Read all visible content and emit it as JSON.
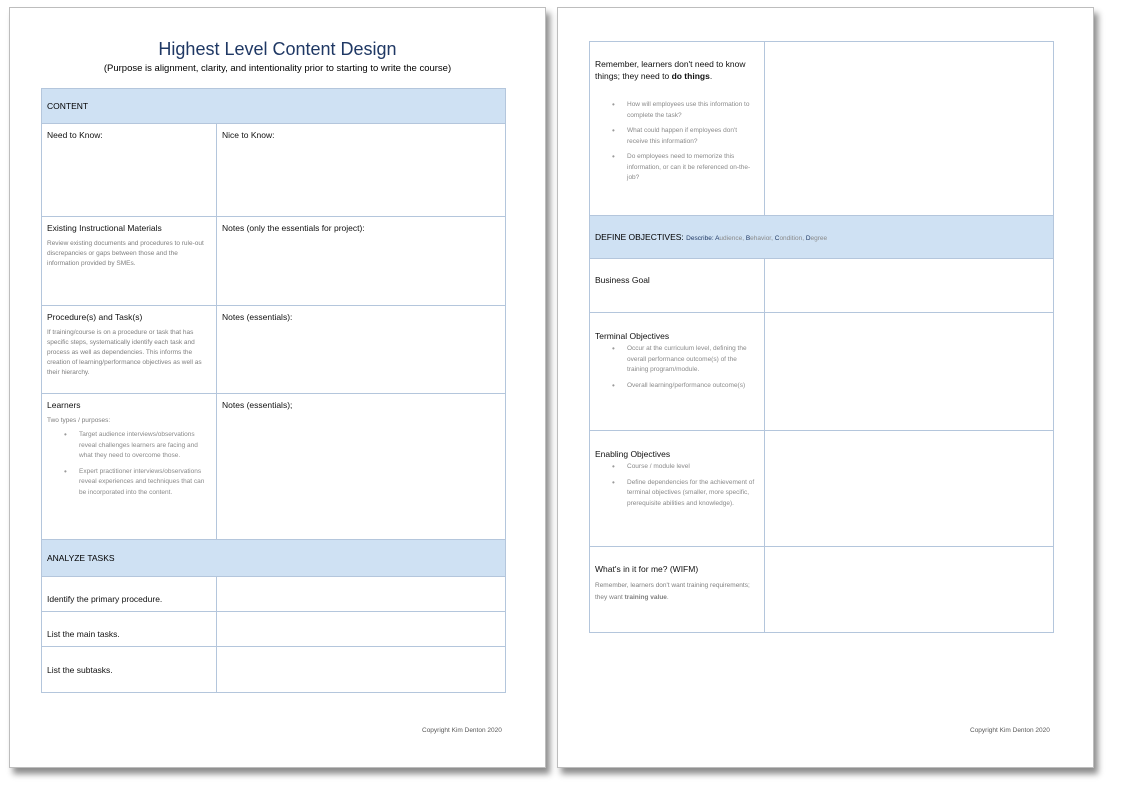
{
  "page1": {
    "title": "Highest Level Content Design",
    "subtitle": "(Purpose is alignment, clarity, and intentionality prior to starting to write the course)",
    "content_header": "CONTENT",
    "need_to_know": "Need to Know:",
    "nice_to_know": "Nice to Know:",
    "existing_label": "Existing Instructional Materials",
    "existing_hint": "Review existing documents and procedures to rule-out discrepancies or gaps between those and the information provided by SMEs.",
    "notes_project": "Notes (only the essentials for project):",
    "procedure_label": "Procedure(s) and Task(s)",
    "procedure_hint": "If training/course is on a procedure or task that has specific steps, systematically identify each task and process as well as dependencies. This informs the creation of learning/performance objectives as well as their hierarchy.",
    "notes_essentials_1": "Notes (essentials):",
    "learners_label": "Learners",
    "learners_hint": "Two types / purposes:",
    "learners_bullets": [
      "Target audience interviews/observations reveal challenges learners are facing and what they need to overcome those.",
      "Expert practitioner interviews/observations reveal experiences and techniques that can be incorporated into the content."
    ],
    "notes_essentials_2": "Notes (essentials);",
    "analyze_header": "ANALYZE TASKS",
    "task_rows": [
      "Identify the primary procedure.",
      "List the main tasks.",
      "List the subtasks."
    ],
    "copyright": "Copyright Kim Denton 2020"
  },
  "page2": {
    "remember_text_1": "Remember, learners don't need to know things; they need to ",
    "remember_bold": "do things",
    "remember_end": ".",
    "remember_bullets": [
      "How will employees use this information to complete the task?",
      "What could happen if employees don't receive this information?",
      "Do employees need to memorize this information, or can it be referenced on-the-job?"
    ],
    "objectives_header": "DEFINE OBJECTIVES:",
    "objectives_desc_prefix": "Describe: ",
    "abcd": [
      {
        "letter": "A",
        "rest": "udience, "
      },
      {
        "letter": "B",
        "rest": "ehavior, "
      },
      {
        "letter": "C",
        "rest": "ondition, "
      },
      {
        "letter": "D",
        "rest": "egree"
      }
    ],
    "business_goal": "Business Goal",
    "terminal_label": "Terminal Objectives",
    "terminal_bullets": [
      "Occur at the curriculum level, defining the overall performance outcome(s) of the training program/module.",
      "Overall learning/performance outcome(s)"
    ],
    "enabling_label": "Enabling Objectives",
    "enabling_bullets": [
      "Course / module level",
      "Define dependencies for the achievement of terminal objectives (smaller, more specific, prerequisite abilities and knowledge)."
    ],
    "wifm_label": "What's in it for me? (WIFM)",
    "wifm_hint_1": "Remember, learners don't want training requirements; they want ",
    "wifm_bold": "training value",
    "wifm_end": ".",
    "copyright": "Copyright Kim Denton 2020"
  }
}
